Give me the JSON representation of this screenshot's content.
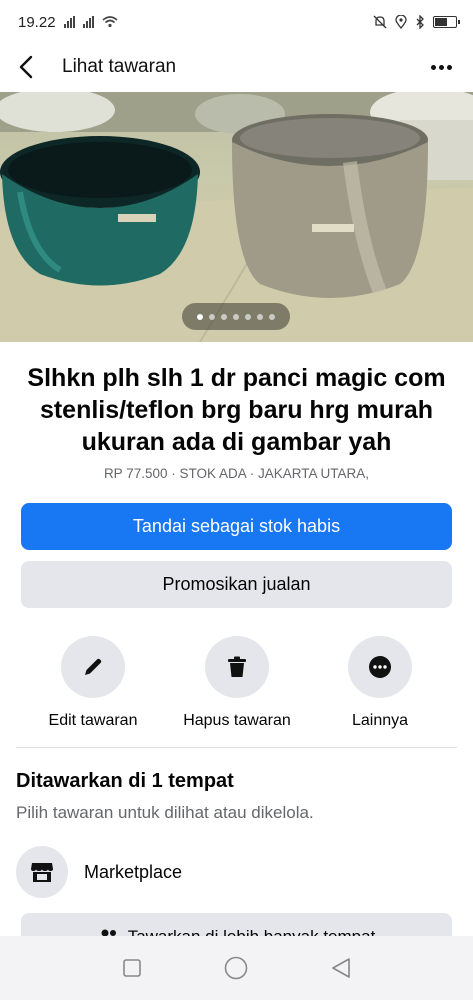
{
  "status_bar": {
    "time": "19.22"
  },
  "header": {
    "title": "Lihat tawaran",
    "back_icon": "chevron-left-icon",
    "more_icon": "more-horizontal-icon"
  },
  "listing": {
    "photo_count": 7,
    "active_photo": 1,
    "title": "Slhkn plh slh 1 dr panci magic com stenlis/teflon brg baru hrg murah ukuran ada di gambar yah",
    "meta": "RP 77.500 · STOK ADA · JAKARTA UTARA,"
  },
  "buttons": {
    "mark_sold": "Tandai sebagai stok habis",
    "promote": "Promosikan jualan"
  },
  "actions": [
    {
      "label": "Edit tawaran",
      "icon": "pencil-icon"
    },
    {
      "label": "Hapus tawaran",
      "icon": "trash-icon"
    },
    {
      "label": "Lainnya",
      "icon": "more-circle-icon"
    }
  ],
  "offered": {
    "title": "Ditawarkan di 1 tempat",
    "subtitle": "Pilih tawaran untuk dilihat atau dikelola.",
    "places": [
      {
        "label": "Marketplace",
        "icon": "marketplace-icon"
      }
    ],
    "more_button": "Tawarkan di lebih banyak tempat"
  },
  "colors": {
    "primary": "#1877f2",
    "secondary_bg": "#e4e6eb",
    "muted_text": "#65676b"
  }
}
